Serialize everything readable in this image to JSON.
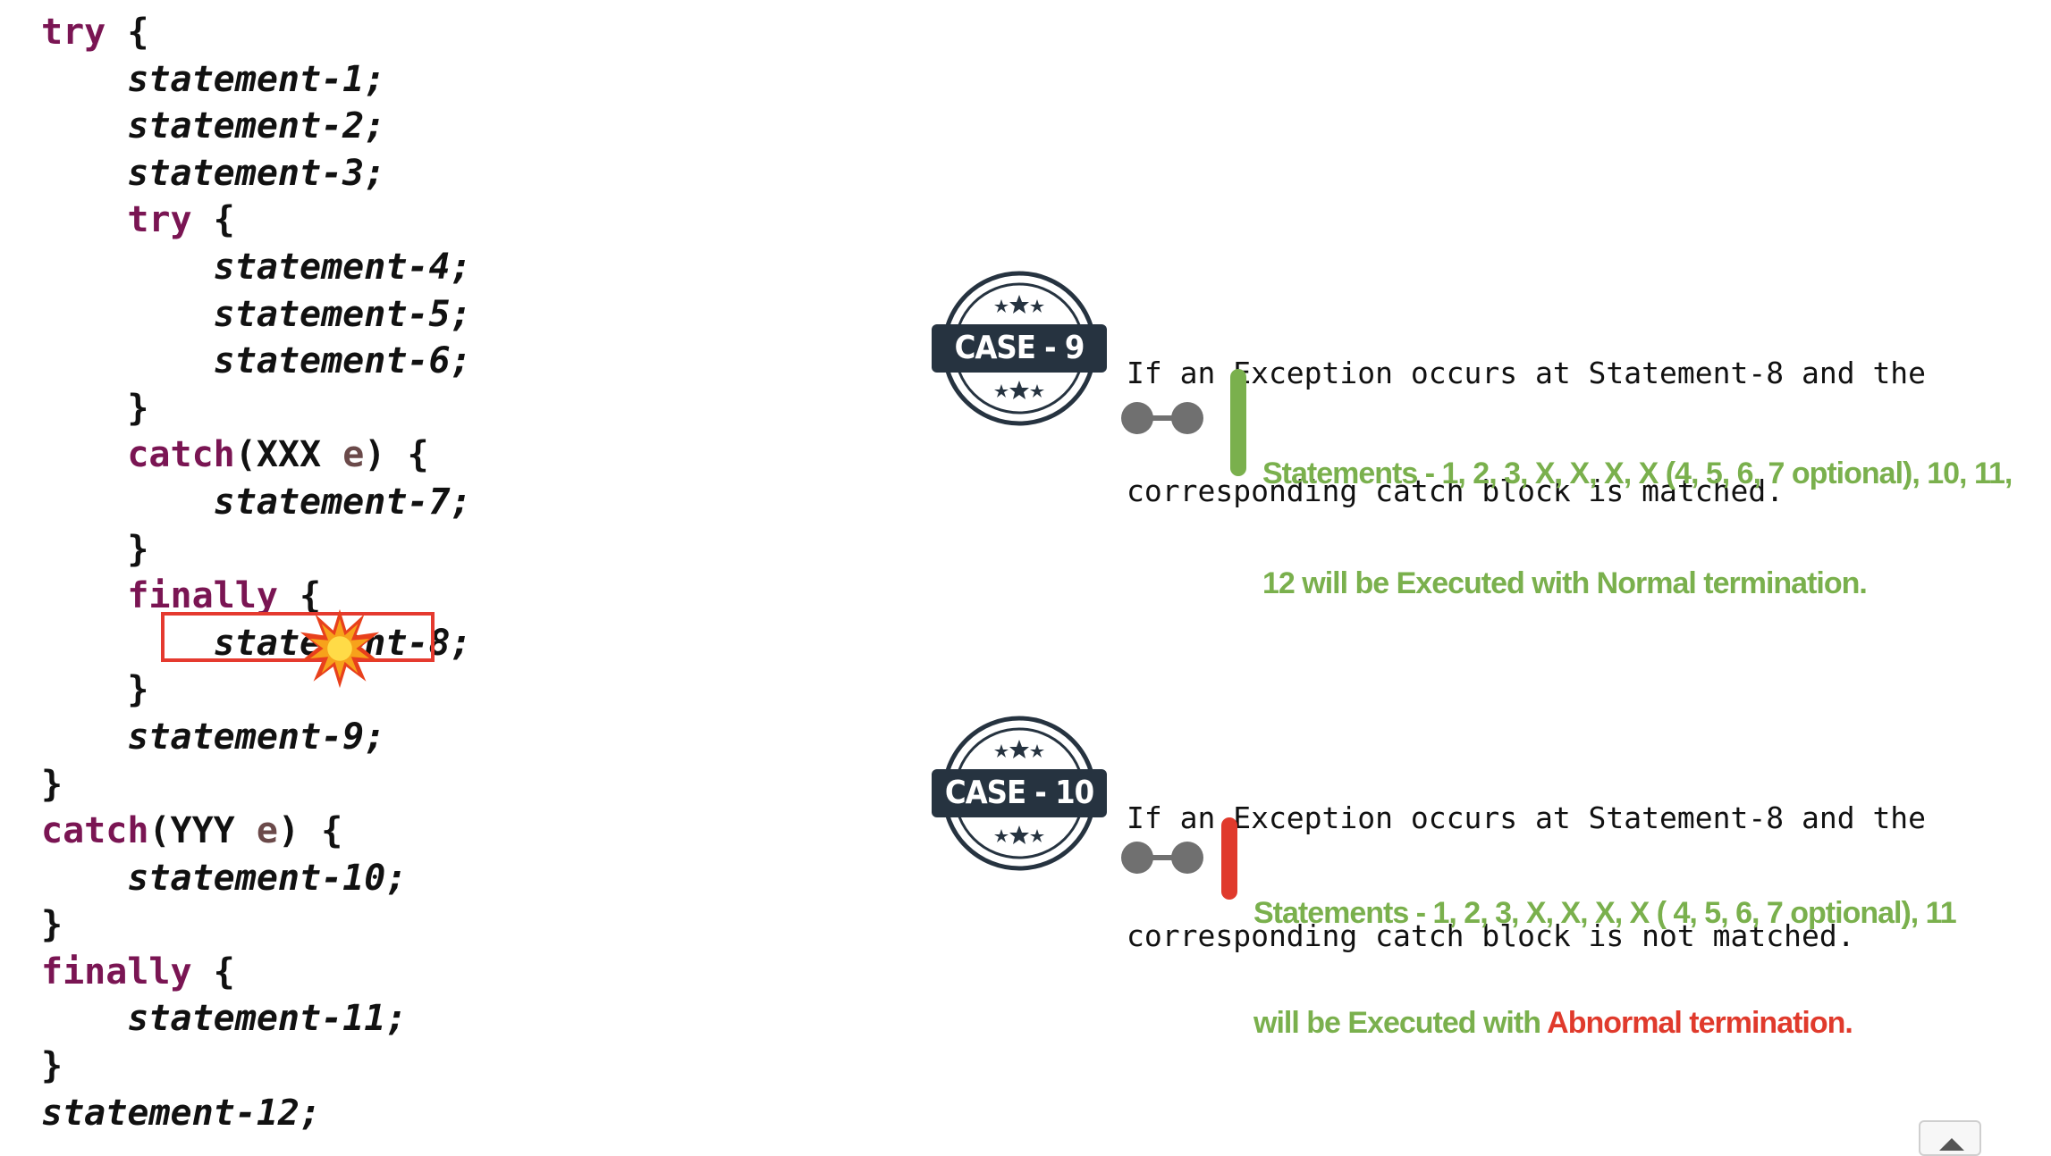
{
  "code": {
    "kw_try": "try",
    "kw_catch": "catch",
    "kw_finally": "finally",
    "brace_open": "{",
    "brace_close": "}",
    "s1": "statement-1;",
    "s2": "statement-2;",
    "s3": "statement-3;",
    "s4": "statement-4;",
    "s5": "statement-5;",
    "s6": "statement-6;",
    "s7": "statement-7;",
    "s8": "statement-8;",
    "s9": "statement-9;",
    "s10": "statement-10;",
    "s11": "statement-11;",
    "s12": "statement-12;",
    "type_inner": "XXX",
    "type_outer": "YYY",
    "var_e": "e",
    "paren_open": "(",
    "paren_close": ")"
  },
  "case9": {
    "badge": "CASE - 9",
    "desc_line1": "If an Exception occurs at Statement-8 and the",
    "desc_line2": "corresponding catch block is matched.",
    "result_line1": "Statements - 1, 2, 3, X, X, X, X (4, 5, 6, 7 optional), 10, 11,",
    "result_line2": "12 will be Executed with Normal termination.",
    "bar_color": "#7ab04d"
  },
  "case10": {
    "badge": "CASE - 10",
    "desc_line1": "If an Exception occurs at Statement-8 and the",
    "desc_line2": "corresponding catch block is not matched.",
    "result_line1": "Statements - 1, 2, 3, X, X, X, X ( 4, 5, 6, 7 optional), 11",
    "result_line2_prefix": "will be Executed with ",
    "result_line2_highlight": "Abnormal termination.",
    "bar_color": "#e03a2c"
  },
  "icons": {
    "explosion": "explosion-icon",
    "stamp": "case-stamp-icon",
    "scroll_up": "scroll-up-icon"
  },
  "colors": {
    "keyword": "#7a1553",
    "result_green": "#7ab04d",
    "abnormal_red": "#e03a2c",
    "highlight_border": "#e53a2f",
    "stamp_dark": "#263340"
  }
}
